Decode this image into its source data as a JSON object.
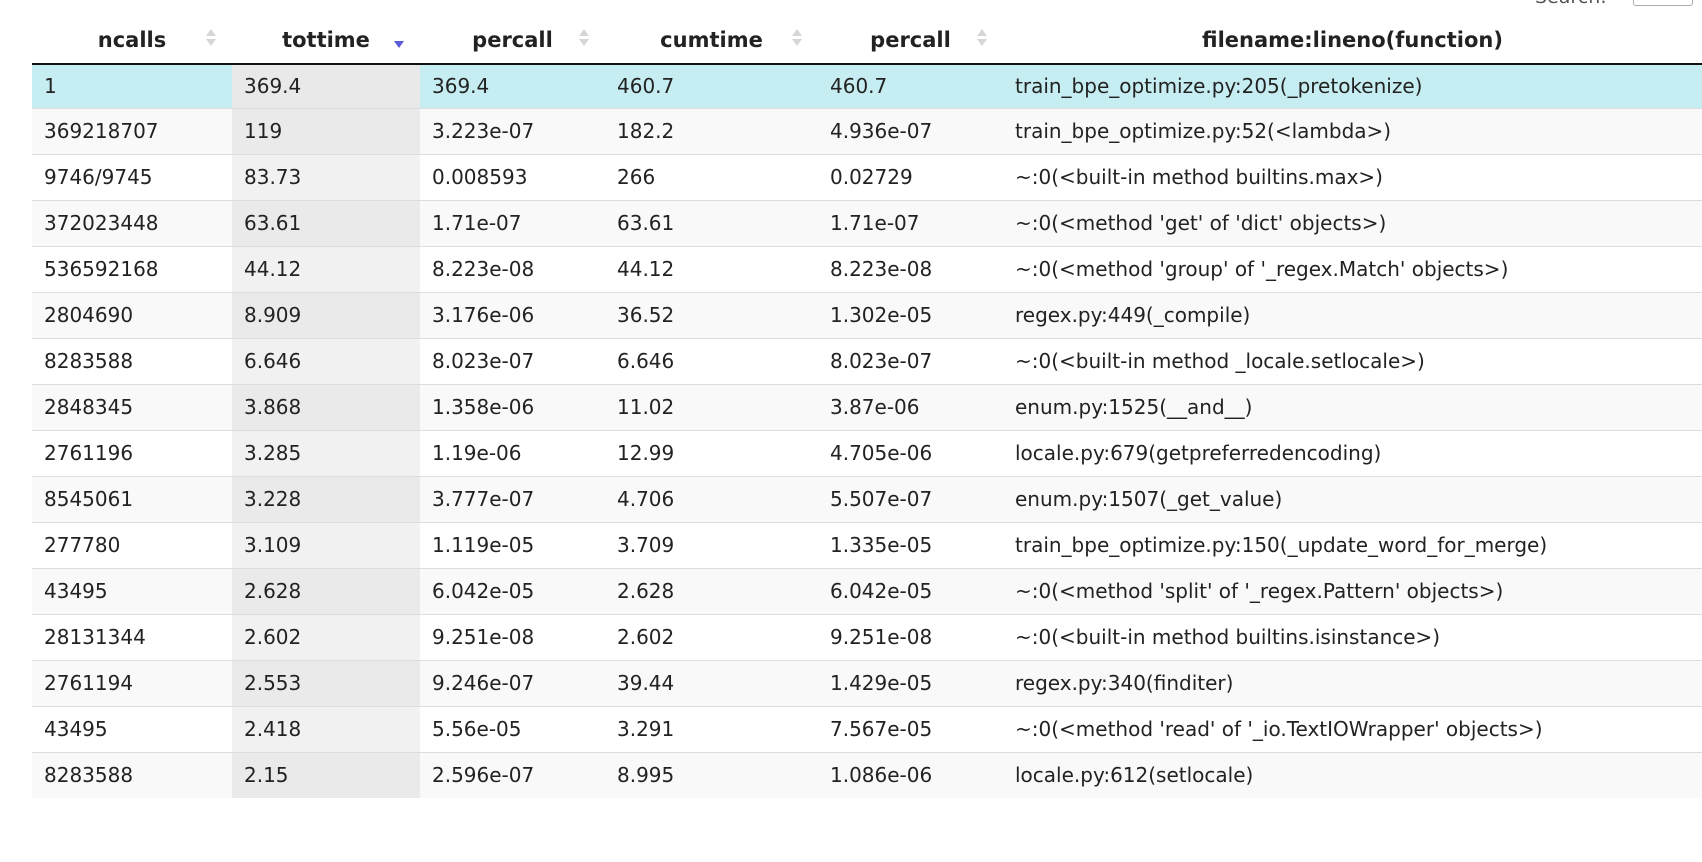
{
  "search": {
    "label": "Search:",
    "value": ""
  },
  "columns": [
    {
      "label": "ncalls",
      "sort": "none"
    },
    {
      "label": "tottime",
      "sort": "desc"
    },
    {
      "label": "percall",
      "sort": "none"
    },
    {
      "label": "cumtime",
      "sort": "none"
    },
    {
      "label": "percall",
      "sort": "none"
    },
    {
      "label": "filename:lineno(function)",
      "sort": "none"
    }
  ],
  "rows": [
    [
      "1",
      "369.4",
      "369.4",
      "460.7",
      "460.7",
      "train_bpe_optimize.py:205(_pretokenize)"
    ],
    [
      "369218707",
      "119",
      "3.223e-07",
      "182.2",
      "4.936e-07",
      "train_bpe_optimize.py:52(<lambda>)"
    ],
    [
      "9746/9745",
      "83.73",
      "0.008593",
      "266",
      "0.02729",
      "~:0(<built-in method builtins.max>)"
    ],
    [
      "372023448",
      "63.61",
      "1.71e-07",
      "63.61",
      "1.71e-07",
      "~:0(<method 'get' of 'dict' objects>)"
    ],
    [
      "536592168",
      "44.12",
      "8.223e-08",
      "44.12",
      "8.223e-08",
      "~:0(<method 'group' of '_regex.Match' objects>)"
    ],
    [
      "2804690",
      "8.909",
      "3.176e-06",
      "36.52",
      "1.302e-05",
      "regex.py:449(_compile)"
    ],
    [
      "8283588",
      "6.646",
      "8.023e-07",
      "6.646",
      "8.023e-07",
      "~:0(<built-in method _locale.setlocale>)"
    ],
    [
      "2848345",
      "3.868",
      "1.358e-06",
      "11.02",
      "3.87e-06",
      "enum.py:1525(__and__)"
    ],
    [
      "2761196",
      "3.285",
      "1.19e-06",
      "12.99",
      "4.705e-06",
      "locale.py:679(getpreferredencoding)"
    ],
    [
      "8545061",
      "3.228",
      "3.777e-07",
      "4.706",
      "5.507e-07",
      "enum.py:1507(_get_value)"
    ],
    [
      "277780",
      "3.109",
      "1.119e-05",
      "3.709",
      "1.335e-05",
      "train_bpe_optimize.py:150(_update_word_for_merge)"
    ],
    [
      "43495",
      "2.628",
      "6.042e-05",
      "2.628",
      "6.042e-05",
      "~:0(<method 'split' of '_regex.Pattern' objects>)"
    ],
    [
      "28131344",
      "2.602",
      "9.251e-08",
      "2.602",
      "9.251e-08",
      "~:0(<built-in method builtins.isinstance>)"
    ],
    [
      "2761194",
      "2.553",
      "9.246e-07",
      "39.44",
      "1.429e-05",
      "regex.py:340(finditer)"
    ],
    [
      "43495",
      "2.418",
      "5.56e-05",
      "3.291",
      "7.567e-05",
      "~:0(<method 'read' of '_io.TextIOWrapper' objects>)"
    ],
    [
      "8283588",
      "2.15",
      "2.596e-07",
      "8.995",
      "1.086e-06",
      "locale.py:612(setlocale)"
    ]
  ],
  "selected_row": 0,
  "sorted_column": 1,
  "colors": {
    "selected_row": "#c6eef2",
    "sort_active": "#5b5bdb",
    "sort_inactive": "#d6d6d6"
  }
}
